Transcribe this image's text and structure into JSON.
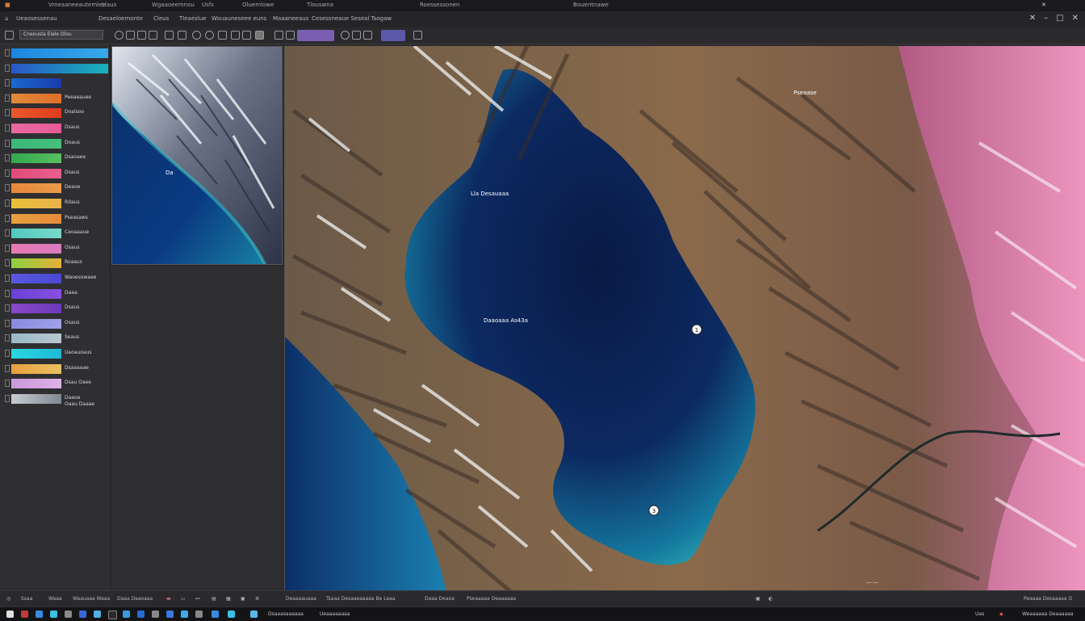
{
  "window": {
    "title_items": [
      "Vmeaaneeautemlee",
      "Llaus",
      "Wgaaoeemnou",
      "Usfs",
      "Oluemlowe",
      "Tlouswna",
      "Roessessonen",
      "Bouentnawe"
    ],
    "controls": [
      "✕",
      "–",
      "□",
      "✕"
    ]
  },
  "menu": {
    "items": [
      "Ueaosessenau",
      "Desaeloemonte",
      "Cleus",
      "Tleaeslue",
      "Wouauneseee euns",
      "Maaaneeaus",
      "Cesessneaue Seseal Tsogaw"
    ]
  },
  "layers_panel": {
    "search_label": "Cneousla  Elele  Dlou",
    "items": [
      {
        "label": "",
        "color_a": "#1c86e0",
        "color_b": "#39a9e8"
      },
      {
        "label": "",
        "color_a": "#2a56c8",
        "color_b": "#18b3b8"
      },
      {
        "label": "",
        "color_a": "#1a6ad0",
        "color_b": "#1a3aa8"
      },
      {
        "label": "Peeaeauee",
        "color_a": "#e08a3a",
        "color_b": "#e06e2a"
      },
      {
        "label": "Doalsoo",
        "color_a": "#e85a2a",
        "color_b": "#e23a1e"
      },
      {
        "label": "Dsaus",
        "color_a": "#e86aa0",
        "color_b": "#e85a96"
      },
      {
        "label": "Doaus",
        "color_a": "#3ab87a",
        "color_b": "#45c07a"
      },
      {
        "label": "Dsaoaee",
        "color_a": "#32a850",
        "color_b": "#58c060"
      },
      {
        "label": "Dsaus",
        "color_a": "#e24a7a",
        "color_b": "#e8608c"
      },
      {
        "label": "Deaoe",
        "color_a": "#e8883a",
        "color_b": "#e89a4a"
      },
      {
        "label": "Rdaus",
        "color_a": "#e8c03a",
        "color_b": "#eab24a"
      },
      {
        "label": "Pseasaws",
        "color_a": "#e8a040",
        "color_b": "#e88a3a"
      },
      {
        "label": "Ceoaaaue",
        "color_a": "#50c8c0",
        "color_b": "#7ad8c8"
      },
      {
        "label": "Osaus",
        "color_a": "#e87ab0",
        "color_b": "#d87ac0"
      },
      {
        "label": "Roaaus",
        "color_a": "#8ad040",
        "color_b": "#e8b03a"
      },
      {
        "label": "Waoesowaee",
        "color_a": "#5a58e0",
        "color_b": "#4a48d0"
      },
      {
        "label": "Daaa",
        "color_a": "#6a40d8",
        "color_b": "#8850e0"
      },
      {
        "label": "Dsaus",
        "color_a": "#8a48c8",
        "color_b": "#6a3ab8"
      },
      {
        "label": "Osaus",
        "color_a": "#8a8ae0",
        "color_b": "#a0a0e8"
      },
      {
        "label": "Seaus",
        "color_a": "#9ab8c8",
        "color_b": "#b8c8d0"
      },
      {
        "label": "Uaoauoaus",
        "color_a": "#28d8e0",
        "color_b": "#20b8d8"
      },
      {
        "label": "Dsaaaaae",
        "color_a": "#e8a040",
        "color_b": "#e8c060"
      },
      {
        "label": "Dsau Oaee",
        "color_a": "#c898d8",
        "color_b": "#e0b0e8"
      },
      {
        "label": "Daaoe",
        "sub": "Oaau Daaae",
        "color_a": "#c8ccd0",
        "color_b": "#808890"
      }
    ]
  },
  "map": {
    "labels": [
      {
        "id": "north",
        "text": "Pseaase"
      },
      {
        "id": "lake-1",
        "text": "Lla Desauaaa"
      },
      {
        "id": "lake-2",
        "text": "Daaoaaa As43a"
      },
      {
        "id": "inset",
        "text": "Da"
      }
    ],
    "markers": [
      "1",
      "3"
    ],
    "scale_text": "--- ---"
  },
  "status_left": [
    "Ssaa",
    "Waaa",
    "Waauaaa Waaa",
    "Daaa Daaoaaa"
  ],
  "status_right": [
    "Deaaaauaaa",
    "Tsaaa Desaaeaaaaa Be  Leaa",
    "Daaa Deaoa",
    "Pseaaaaa Oeaaaaaa"
  ],
  "status_right_end": "Peaaaa  Desaaaaa O",
  "taskbar": {
    "items": [
      "Dsaaasaaaaaa",
      "Ueaaaaaaaa"
    ],
    "tray": [
      "Uas",
      "Weaaaaaa Deaaaaaa"
    ]
  }
}
